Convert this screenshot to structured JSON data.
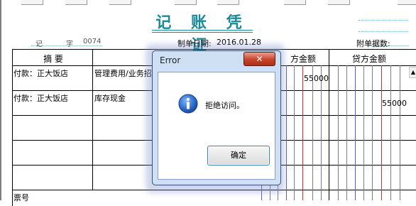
{
  "voucher": {
    "title": "记 账 凭 证",
    "voucher_word_label": "记",
    "voucher_no_label": "字",
    "voucher_no": "0074",
    "date_label": "制单日期:",
    "date": "2016.01.28",
    "attachments_label": "附单据数:",
    "notes_label": "票号"
  },
  "table": {
    "headers": {
      "summary": "摘 要",
      "debit": "方金额",
      "credit": "贷方金额"
    },
    "rows": [
      {
        "summary": "付款：正大饭店",
        "account": "管理费用/业务招",
        "debit": "55000",
        "credit": ""
      },
      {
        "summary": "付款：正大饭店",
        "account": "库存现金",
        "debit": "",
        "credit": "55000"
      }
    ]
  },
  "dialog": {
    "title": "Error",
    "close_label": "✕",
    "message": "拒绝访问。",
    "ok_label": "确定",
    "icon": "info-icon"
  },
  "colors": {
    "title": "#1a8a9a",
    "dialog_frame": "#cfe0f4",
    "close_button": "#c8432a"
  }
}
